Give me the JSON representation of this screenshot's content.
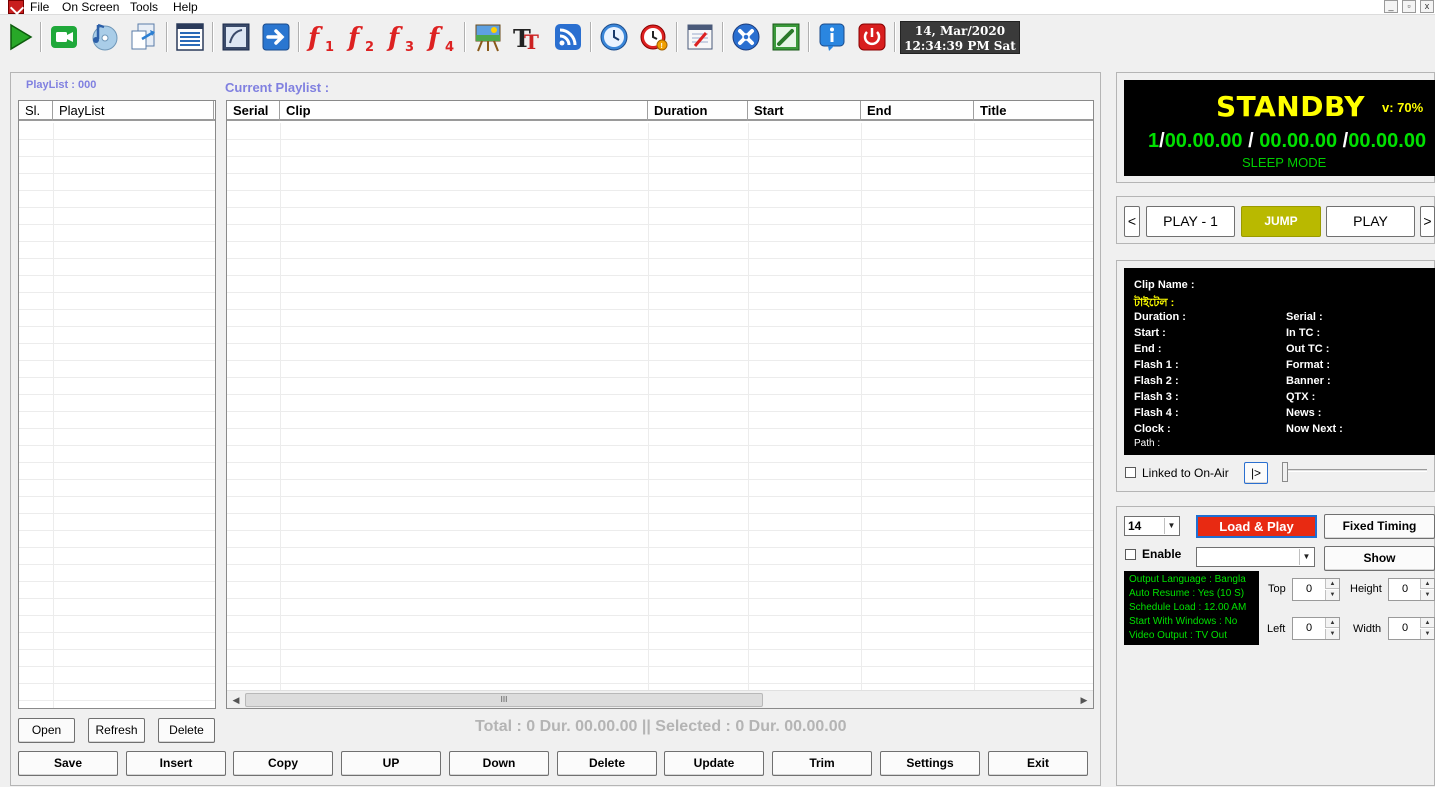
{
  "menu": {
    "items": [
      "File",
      "On Screen",
      "Tools",
      "Help"
    ]
  },
  "window_controls": {
    "minimize": "_",
    "restore": "▫",
    "close": "x"
  },
  "toolbar": {
    "flash_labels": [
      "1",
      "2",
      "3",
      "4"
    ],
    "clock_date": "14, Mar/2020",
    "clock_time": "12:34:39 PM Sat"
  },
  "playlist": {
    "label": "PlayList : 000",
    "columns": [
      "Sl.",
      "PlayList"
    ],
    "buttons": [
      "Open",
      "Refresh",
      "Delete"
    ]
  },
  "current_playlist": {
    "label": "Current Playlist :",
    "columns": [
      "Serial",
      "Clip",
      "Duration",
      "Start",
      "End",
      "Title"
    ],
    "scroll_grip": "III",
    "totals": "Total : 0 Dur.  00.00.00 || Selected : 0 Dur. 00.00.00"
  },
  "bottom_buttons": [
    "Save",
    "Insert",
    "Copy",
    "UP",
    "Down",
    "Delete",
    "Update",
    "Trim",
    "Settings",
    "Exit"
  ],
  "status": {
    "state": "STANDBY",
    "volume": "v: 70%",
    "count": "1",
    "sep": "/",
    "t1": "00.00.00",
    "t2": "00.00.00",
    "t3": "00.00.00",
    "mode": "SLEEP MODE"
  },
  "nav": {
    "prev": "<",
    "play_prev": "PLAY - 1",
    "jump": "JUMP",
    "play": "PLAY",
    "next": ">"
  },
  "clip_info": {
    "clip_name": "Clip Name :",
    "title_bn": "টাইটেল :",
    "left": [
      "Duration :",
      "Start :",
      "End :",
      "Flash 1 :",
      "Flash 2 :",
      "Flash 3 :",
      "Flash 4 :",
      "Clock :"
    ],
    "right": [
      "Serial :",
      "In TC :",
      "Out TC :",
      "Format :",
      "Banner :",
      "QTX :",
      "News :",
      "Now Next :"
    ],
    "path": "Path :"
  },
  "linked": {
    "label": "Linked to On-Air",
    "play_btn": "|>"
  },
  "controls": {
    "size_value": "14",
    "load_play": "Load & Play",
    "fixed_timing": "Fixed Timing",
    "enable": "Enable",
    "show": "Show",
    "output_lines": [
      "Output Language : Bangla",
      "Auto Resume : Yes (10 S)",
      "Schedule Load : 12.00 AM",
      "Start With Windows : No",
      "Video Output : TV Out"
    ],
    "top_label": "Top",
    "top_value": "0",
    "height_label": "Height",
    "height_value": "0",
    "left_label": "Left",
    "left_value": "0",
    "width_label": "Width",
    "width_value": "0"
  },
  "colors": {
    "accent_label": "#8080e0",
    "standby": "#ffff00",
    "timer": "#00e000",
    "load_play": "#e82a12",
    "jump": "#b9b900"
  }
}
